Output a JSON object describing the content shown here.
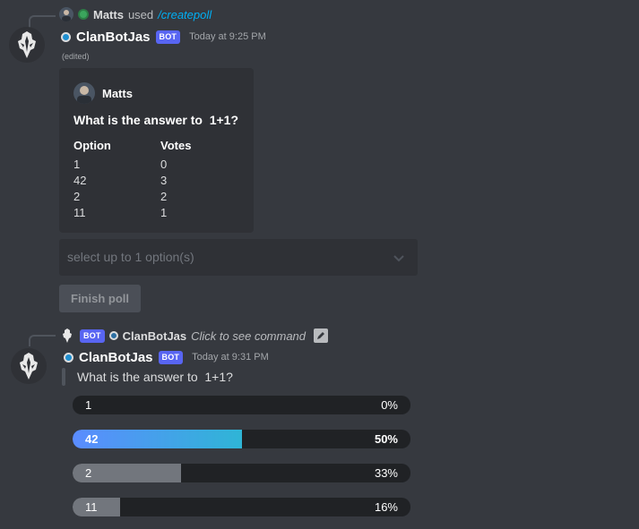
{
  "first_message": {
    "reply_header": {
      "user": "Matts",
      "action": "used",
      "command": "/createpoll"
    },
    "author": "ClanBotJas",
    "bot_badge": "BOT",
    "timestamp": "Today at 9:25 PM",
    "edited": "(edited)",
    "embed": {
      "author": "Matts",
      "title": "What is the answer to  1+1?",
      "col_option": "Option",
      "col_votes": "Votes",
      "rows": [
        {
          "option": "1",
          "votes": "0"
        },
        {
          "option": "42",
          "votes": "3"
        },
        {
          "option": "2",
          "votes": "2"
        },
        {
          "option": "11",
          "votes": "1"
        }
      ]
    },
    "select_placeholder": "select up to 1 option(s)",
    "finish_button": "Finish poll"
  },
  "second_message": {
    "reply_header": {
      "bot_badge": "BOT",
      "user": "ClanBotJas",
      "hint": "Click to see command"
    },
    "author": "ClanBotJas",
    "bot_badge": "BOT",
    "timestamp": "Today at 9:31 PM",
    "question": "What is the answer to  1+1?",
    "results": [
      {
        "label": "1",
        "percent_text": "0%",
        "fraction": 0.0,
        "color": "#72767d",
        "bold": false
      },
      {
        "label": "42",
        "percent_text": "50%",
        "fraction": 0.5,
        "color": "gradient",
        "bold": true
      },
      {
        "label": "2",
        "percent_text": "33%",
        "fraction": 0.32,
        "color": "#72767d",
        "bold": false
      },
      {
        "label": "11",
        "percent_text": "16%",
        "fraction": 0.14,
        "color": "#72767d",
        "bold": false
      }
    ]
  },
  "colors": {
    "background": "#36393f",
    "embed": "#2f3136",
    "bot_badge": "#5865f2",
    "command_link": "#00aff4",
    "winner_gradient_start": "#5b8cff",
    "winner_gradient_end": "#2fb5d6"
  }
}
